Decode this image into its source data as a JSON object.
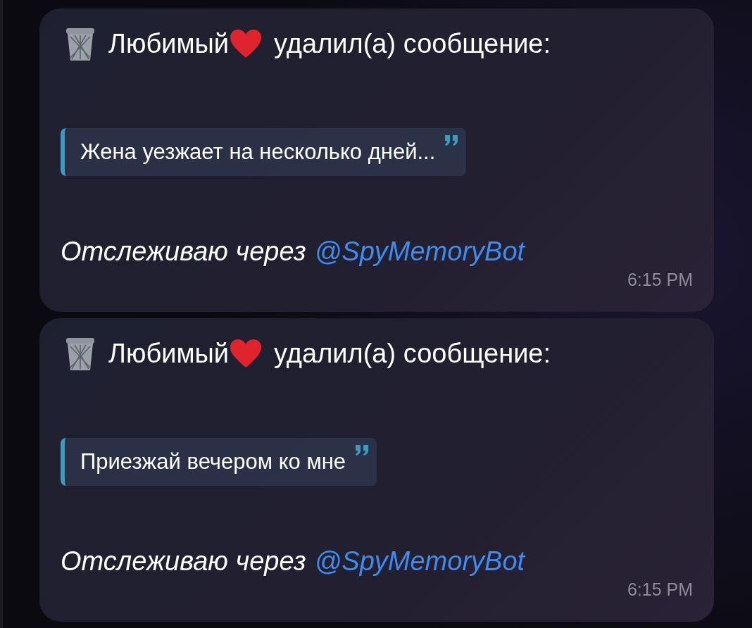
{
  "messages": [
    {
      "sender": "Любимый",
      "action": "удалил(а) сообщение:",
      "quote": "Жена уезжает на несколько дней...",
      "footer": {
        "text": "Отслеживаю через",
        "link": "@SpyMemoryBot"
      },
      "time": "6:15 PM"
    },
    {
      "sender": "Любимый",
      "action": "удалил(а) сообщение:",
      "quote": "Приезжай вечером ко мне",
      "footer": {
        "text": "Отслеживаю через",
        "link": "@SpyMemoryBot"
      },
      "time": "6:15 PM"
    }
  ]
}
